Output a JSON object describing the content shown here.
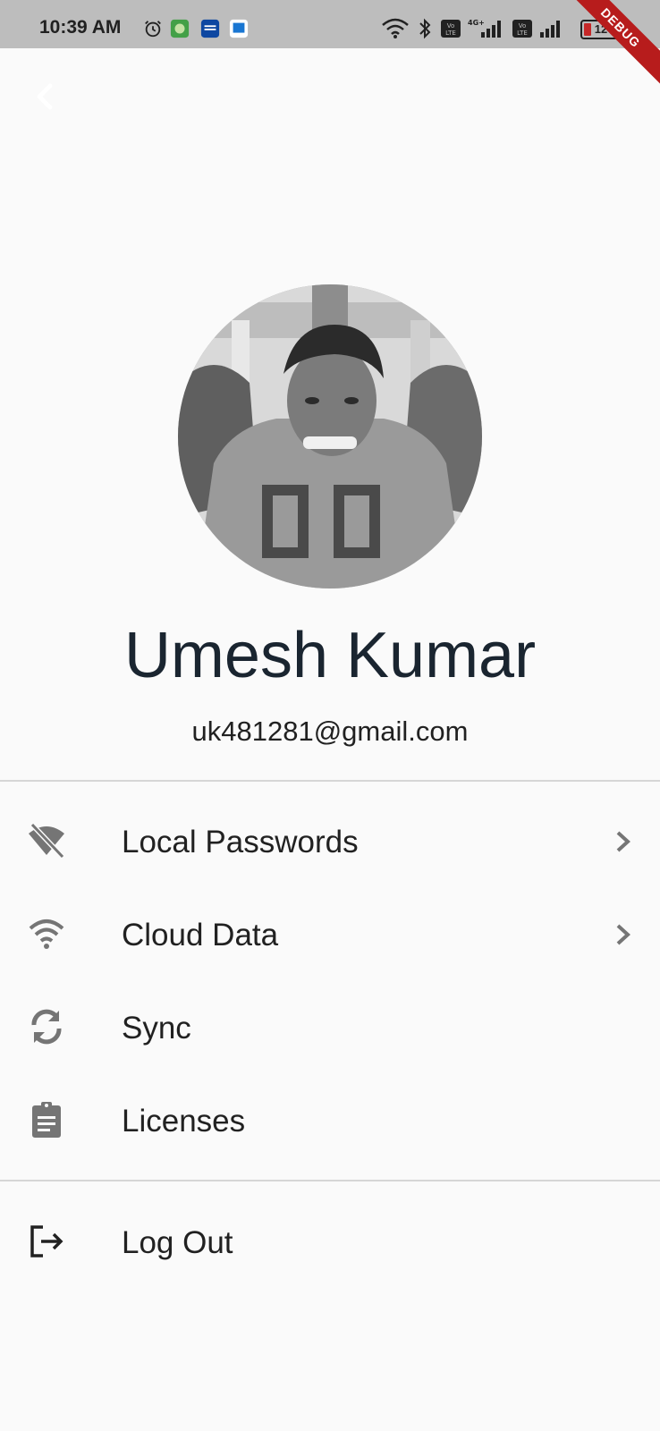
{
  "status_bar": {
    "time": "10:39 AM",
    "battery": "12"
  },
  "debug_banner": "DEBUG",
  "profile": {
    "name": "Umesh Kumar",
    "email": "uk481281@gmail.com"
  },
  "menu": [
    {
      "label": "Local Passwords",
      "icon": "wifi-off-icon",
      "has_chevron": true
    },
    {
      "label": "Cloud Data",
      "icon": "wifi-icon",
      "has_chevron": true
    },
    {
      "label": "Sync",
      "icon": "sync-icon",
      "has_chevron": false
    },
    {
      "label": "Licenses",
      "icon": "clipboard-icon",
      "has_chevron": false
    }
  ],
  "logout": {
    "label": "Log Out",
    "icon": "logout-icon"
  },
  "colors": {
    "background": "#fafafa",
    "status_bar": "#bdbdbd",
    "name_text": "#1a2530",
    "icon_grey": "#757575",
    "debug_red": "#b71c1c"
  }
}
